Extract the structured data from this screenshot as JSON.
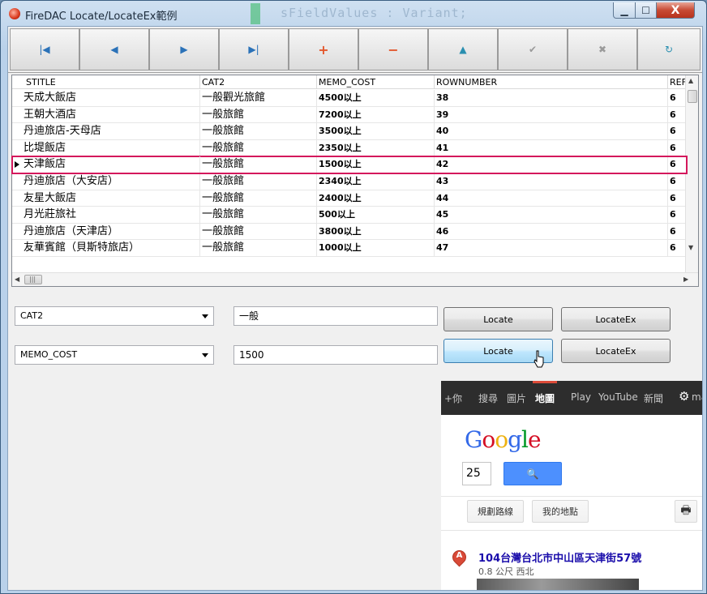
{
  "window": {
    "title": "FireDAC Locate/LocateEx範例",
    "bg_code": "sFieldValues : Variant;",
    "min_glyph": "▁",
    "max_glyph": "☐",
    "close_glyph": "X"
  },
  "navigator": {
    "buttons": [
      {
        "name": "first-record-button",
        "glyph": "|◀",
        "style": "blue"
      },
      {
        "name": "prior-record-button",
        "glyph": "◀",
        "style": "blue"
      },
      {
        "name": "next-record-button",
        "glyph": "▶",
        "style": "blue"
      },
      {
        "name": "last-record-button",
        "glyph": "▶|",
        "style": "blue"
      },
      {
        "name": "insert-record-button",
        "glyph": "+",
        "style": "red"
      },
      {
        "name": "delete-record-button",
        "glyph": "−",
        "style": "red"
      },
      {
        "name": "edit-record-button",
        "glyph": "▲",
        "style": "teal"
      },
      {
        "name": "post-edit-button",
        "glyph": "✔",
        "style": "gray"
      },
      {
        "name": "cancel-edit-button",
        "glyph": "✖",
        "style": "gray"
      },
      {
        "name": "refresh-button",
        "glyph": "↻",
        "style": "teal"
      }
    ]
  },
  "grid": {
    "columns": [
      "STITLE",
      "CAT2",
      "MEMO_COST",
      "ROWNUMBER",
      "REF_"
    ],
    "rows": [
      [
        "天成大飯店",
        "一般觀光旅館",
        "4500以上",
        "38",
        "6"
      ],
      [
        "王朝大酒店",
        "一般旅館",
        "7200以上",
        "39",
        "6"
      ],
      [
        "丹迪旅店-天母店",
        "一般旅館",
        "3500以上",
        "40",
        "6"
      ],
      [
        "比堤飯店",
        "一般旅館",
        "2350以上",
        "41",
        "6"
      ],
      [
        "天津飯店",
        "一般旅館",
        "1500以上",
        "42",
        "6"
      ],
      [
        "丹迪旅店（大安店）",
        "一般旅館",
        "2340以上",
        "43",
        "6"
      ],
      [
        "友星大飯店",
        "一般旅館",
        "2400以上",
        "44",
        "6"
      ],
      [
        "月光莊旅社",
        "一般旅館",
        "500以上",
        "45",
        "6"
      ],
      [
        "丹迪旅店（天津店）",
        "一般旅館",
        "3800以上",
        "46",
        "6"
      ],
      [
        "友華賓館（貝斯特旅店）",
        "一般旅館",
        "1000以上",
        "47",
        "6"
      ]
    ],
    "selected_row": 4,
    "scroll_glyphs": {
      "up": "▲",
      "down": "▼",
      "left": "◀",
      "right": "▶",
      "thumb": "|||"
    }
  },
  "search": {
    "field1": {
      "combo": "CAT2",
      "value": "一般"
    },
    "field2": {
      "combo": "MEMO_COST",
      "value": "1500"
    },
    "locate_label": "Locate",
    "locateex_label": "LocateEx"
  },
  "map": {
    "nav": [
      "+你",
      "搜尋",
      "圖片",
      "地圖",
      "Play",
      "YouTube",
      "新聞",
      "⚙",
      "ma"
    ],
    "active_nav": "地圖",
    "logo_letters": [
      "G",
      "o",
      "o",
      "g",
      "l",
      "e"
    ],
    "logo_colors": [
      "#3369e8",
      "#d50f25",
      "#eeb211",
      "#3369e8",
      "#009925",
      "#d50f25"
    ],
    "search_value": "25",
    "search_icon": "🔍",
    "directions_label": "規劃路線",
    "my_places_label": "我的地點",
    "print_icon": "🖶",
    "marker_letter": "A",
    "address": "104台灣台北市中山區天津街57號",
    "distance": "0.8 公尺 西北"
  }
}
